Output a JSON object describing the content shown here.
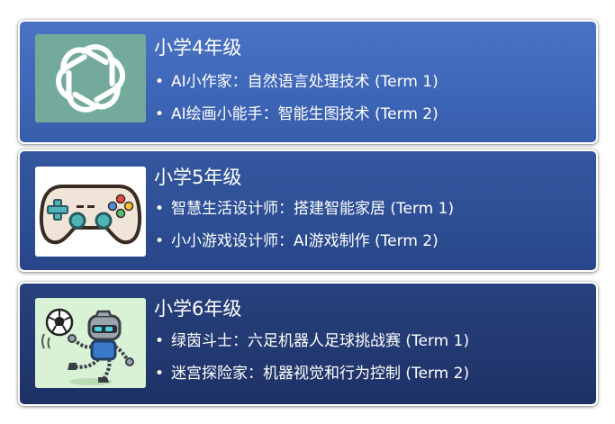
{
  "cards": [
    {
      "grade": "小学4年级",
      "image_icon": "openai-logo-icon",
      "items": [
        "AI小作家：自然语言处理技术 (Term 1)",
        "AI绘画小能手：智能生图技术 (Term 2)"
      ]
    },
    {
      "grade": "小学5年级",
      "image_icon": "game-controller-icon",
      "items": [
        "智慧生活设计师：搭建智能家居 (Term 1)",
        "小小游戏设计师：AI游戏制作 (Term 2)"
      ]
    },
    {
      "grade": "小学6年级",
      "image_icon": "soccer-robot-icon",
      "items": [
        "绿茵斗士：六足机器人足球挑战赛 (Term 1)",
        "迷宫探险家：机器视觉和行为控制 (Term 2)"
      ]
    }
  ],
  "colors": {
    "card1": "#3e66b8",
    "card2": "#2d4e94",
    "card3": "#223870",
    "openai_bg": "#74aa9c"
  }
}
